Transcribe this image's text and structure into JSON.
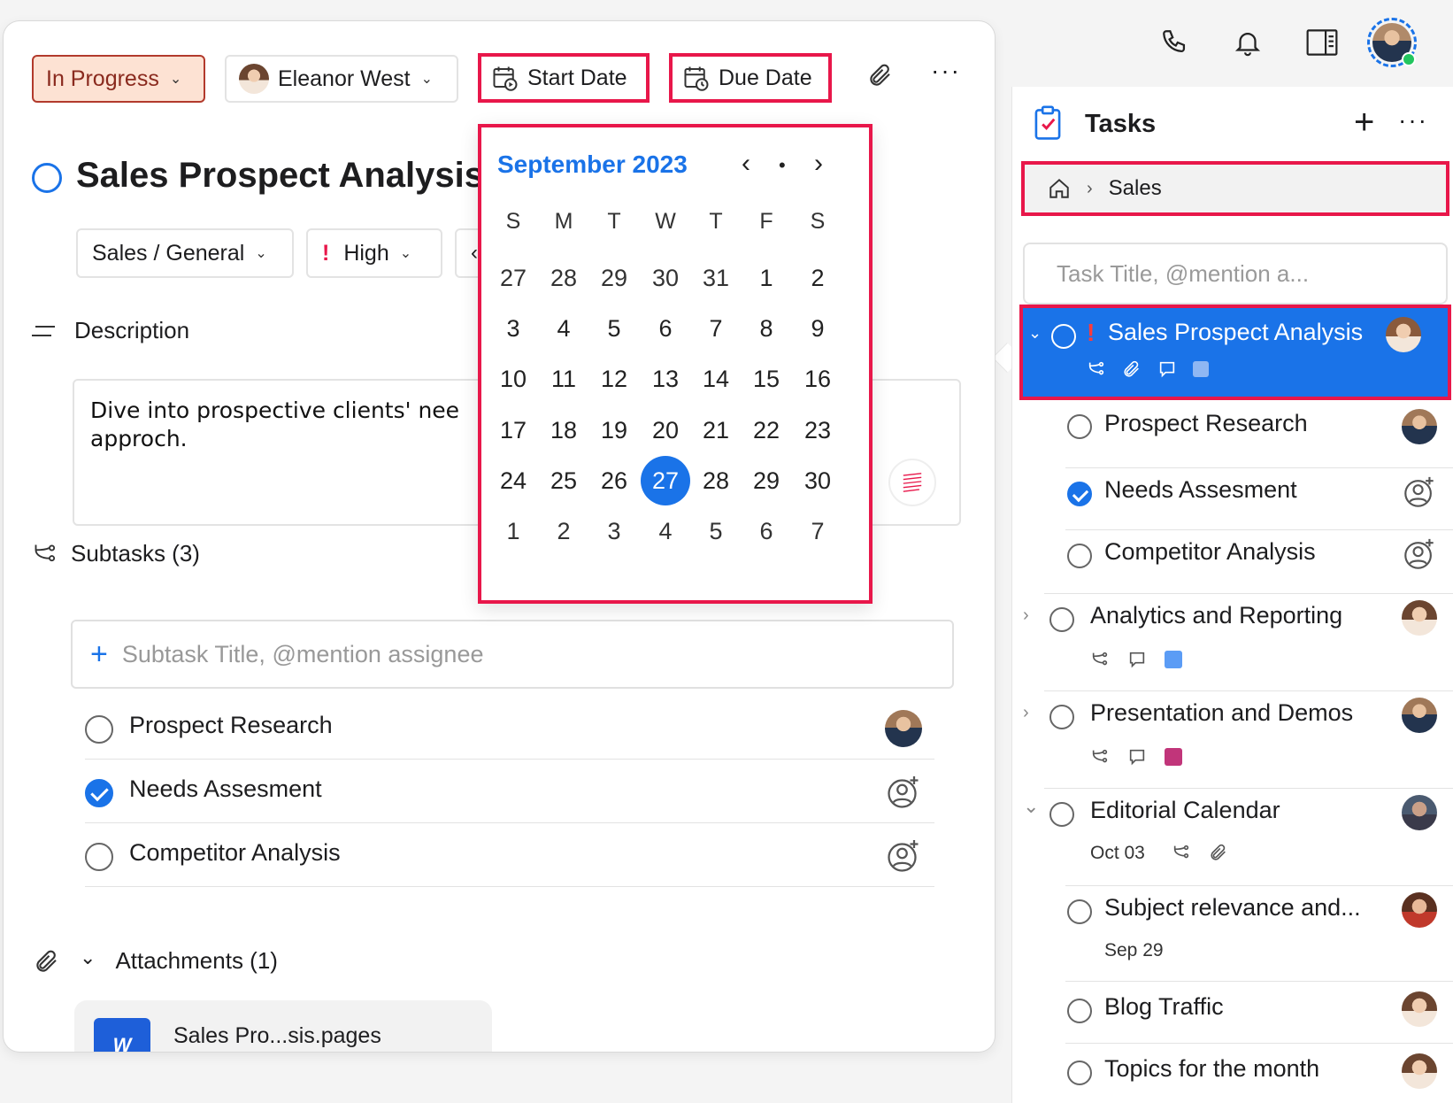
{
  "colors": {
    "accent": "#1a73e8",
    "highlight": "#e8174a",
    "status_bg": "#fde2d3",
    "status_border": "#b23a2c",
    "analytics_tag": "#5b9cf5",
    "presentation_tag": "#c1357a",
    "sales_tag": "#8fb7f3"
  },
  "topbar": {
    "icons": [
      "phone-icon",
      "bell-icon",
      "sidebar-toggle-icon",
      "user-avatar"
    ]
  },
  "card": {
    "status": "In Progress",
    "assignee": "Eleanor West",
    "start_date_label": "Start Date",
    "due_date_label": "Due Date",
    "title": "Sales Prospect Analysis",
    "project": "Sales / General",
    "priority": "High",
    "description_label": "Description",
    "description": "Dive into prospective clients' nee\napproch.",
    "subtasks_label": "Subtasks (3)",
    "subtask_placeholder": "Subtask Title, @mention assignee",
    "subtasks": [
      {
        "label": "Prospect Research",
        "done": false
      },
      {
        "label": "Needs Assesment",
        "done": true
      },
      {
        "label": "Competitor Analysis",
        "done": false
      }
    ],
    "attachments_label": "Attachments (1)",
    "attachment_file": "Sales Pro...sis.pages",
    "file_icon_text": "W"
  },
  "calendar": {
    "month_label": "September 2023",
    "weekdays": [
      "S",
      "M",
      "T",
      "W",
      "T",
      "F",
      "S"
    ],
    "weeks": [
      [
        "27",
        "28",
        "29",
        "30",
        "31",
        "1",
        "2"
      ],
      [
        "3",
        "4",
        "5",
        "6",
        "7",
        "8",
        "9"
      ],
      [
        "10",
        "11",
        "12",
        "13",
        "14",
        "15",
        "16"
      ],
      [
        "17",
        "18",
        "19",
        "20",
        "21",
        "22",
        "23"
      ],
      [
        "24",
        "25",
        "26",
        "27",
        "28",
        "29",
        "30"
      ],
      [
        "1",
        "2",
        "3",
        "4",
        "5",
        "6",
        "7"
      ]
    ],
    "selected_day": "27"
  },
  "panel": {
    "title": "Tasks",
    "breadcrumb_current": "Sales",
    "task_placeholder": "Task Title, @mention a...",
    "selected_task": "Sales Prospect Analysis",
    "tasks": [
      {
        "label": "Prospect Research"
      },
      {
        "label": "Needs Assesment"
      },
      {
        "label": "Competitor Analysis"
      },
      {
        "label": "Analytics and Reporting"
      },
      {
        "label": "Presentation and Demos"
      },
      {
        "label": "Editorial Calendar",
        "date": "Oct 03"
      },
      {
        "label": "Subject relevance and...",
        "date": "Sep 29"
      },
      {
        "label": "Blog Traffic"
      },
      {
        "label": "Topics for the month"
      }
    ]
  }
}
